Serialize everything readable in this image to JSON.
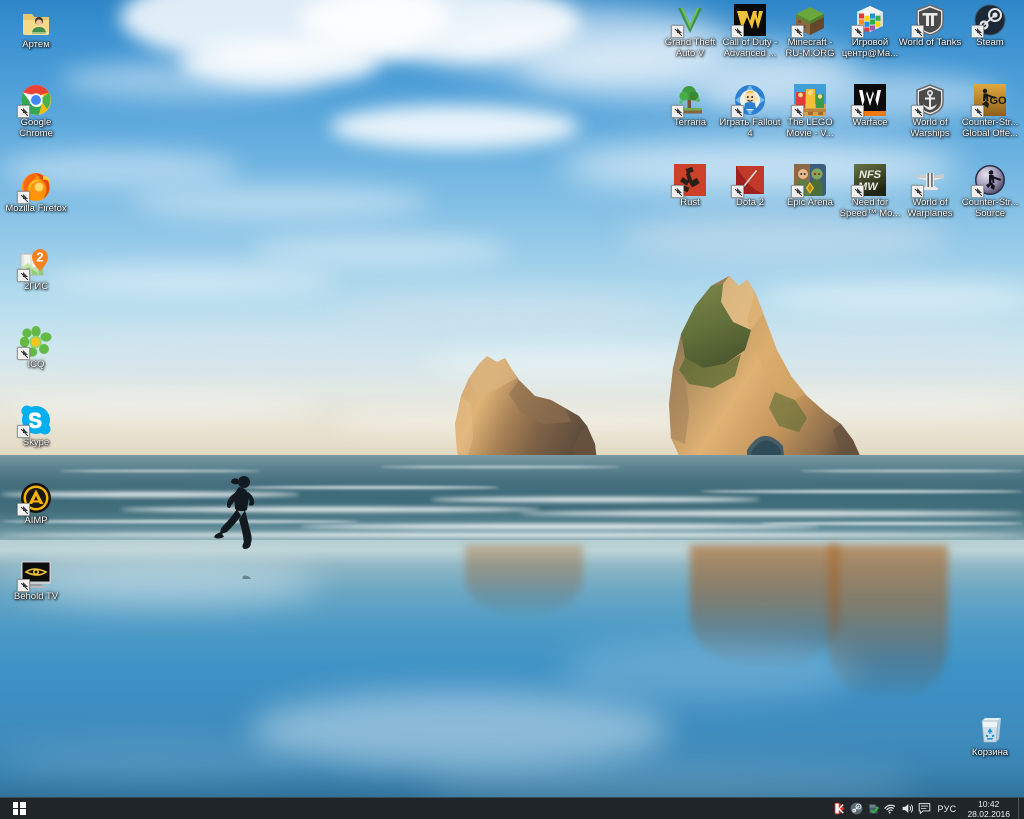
{
  "os": {
    "name": "Windows 10 Desktop",
    "wallpaper_description": "Wharariki Beach, New Zealand — Archway Islands sea stacks with runner reflected on wet sand"
  },
  "desktop_icons_left": [
    {
      "label": "Артем",
      "icon": "user-folder-icon",
      "shortcut": false
    },
    {
      "label": "Google Chrome",
      "icon": "google-chrome-icon",
      "shortcut": true
    },
    {
      "label": "Mozilla Firefox",
      "icon": "mozilla-firefox-icon",
      "shortcut": true
    },
    {
      "label": "2ГИС",
      "icon": "2gis-icon",
      "shortcut": true
    },
    {
      "label": "ICQ",
      "icon": "icq-flower-icon",
      "shortcut": true
    },
    {
      "label": "Skype",
      "icon": "skype-icon",
      "shortcut": true
    },
    {
      "label": "AIMP",
      "icon": "aimp-icon",
      "shortcut": true
    },
    {
      "label": "Behold TV",
      "icon": "behold-tv-icon",
      "shortcut": true
    }
  ],
  "desktop_icons_grid": [
    {
      "label": "Grand Theft Auto V",
      "icon": "gta-v-icon",
      "shortcut": true
    },
    {
      "label": "Call of Duty - Advanced ...",
      "icon": "call-of-duty-aw-icon",
      "shortcut": true
    },
    {
      "label": "Minecraft - RU-M.ORG",
      "icon": "minecraft-icon",
      "shortcut": true
    },
    {
      "label": "Игровой центр@Ma...",
      "icon": "mailru-game-center-icon",
      "shortcut": true
    },
    {
      "label": "World of Tanks",
      "icon": "world-of-tanks-icon",
      "shortcut": true
    },
    {
      "label": "Steam",
      "icon": "steam-icon",
      "shortcut": true
    },
    {
      "label": "Terraria",
      "icon": "terraria-icon",
      "shortcut": true
    },
    {
      "label": "Играть Fallout 4",
      "icon": "fallout-4-vaultboy-icon",
      "shortcut": true
    },
    {
      "label": "The LEGO Movie - V...",
      "icon": "lego-movie-icon",
      "shortcut": true
    },
    {
      "label": "Warface",
      "icon": "warface-icon",
      "shortcut": true
    },
    {
      "label": "World of Warships",
      "icon": "world-of-warships-icon",
      "shortcut": true
    },
    {
      "label": "Counter-Str... Global Offe...",
      "icon": "csgo-icon",
      "shortcut": true
    },
    {
      "label": "Rust",
      "icon": "rust-icon",
      "shortcut": true
    },
    {
      "label": "Dota 2",
      "icon": "dota-2-icon",
      "shortcut": true
    },
    {
      "label": "Epic Arena",
      "icon": "epic-arena-icon",
      "shortcut": true
    },
    {
      "label": "Need for Speed™ Mo...",
      "icon": "nfs-most-wanted-icon",
      "shortcut": true
    },
    {
      "label": "World of Warplanes",
      "icon": "world-of-warplanes-icon",
      "shortcut": true
    },
    {
      "label": "Counter-Str... Source",
      "icon": "css-icon",
      "shortcut": true
    }
  ],
  "recycle_bin": {
    "label": "Корзина",
    "icon": "recycle-bin-icon"
  },
  "taskbar": {
    "start_button": {
      "label": "Пуск",
      "icon": "windows-logo-icon"
    },
    "tray_icons": [
      {
        "name": "kaspersky-icon",
        "title": "Kaspersky"
      },
      {
        "name": "steam-tray-icon",
        "title": "Steam"
      },
      {
        "name": "installer-tray-icon",
        "title": "Installer"
      },
      {
        "name": "wifi-icon",
        "title": "Сеть"
      },
      {
        "name": "volume-icon",
        "title": "Динамики"
      },
      {
        "name": "action-center-icon",
        "title": "Центр уведомлений"
      }
    ],
    "language": "РУС",
    "clock": {
      "time": "10:42",
      "date": "28.02.2016"
    },
    "show_desktop": {
      "label": "Свернуть все окна"
    }
  },
  "colors": {
    "taskbar_bg": "#1f2529",
    "taskbar_text": "#e9eef2",
    "icon_label_text": "#ffffff",
    "sky_top": "#2e86c8",
    "sea": "#3d6b79",
    "wet_sand": "#3f93c6"
  }
}
